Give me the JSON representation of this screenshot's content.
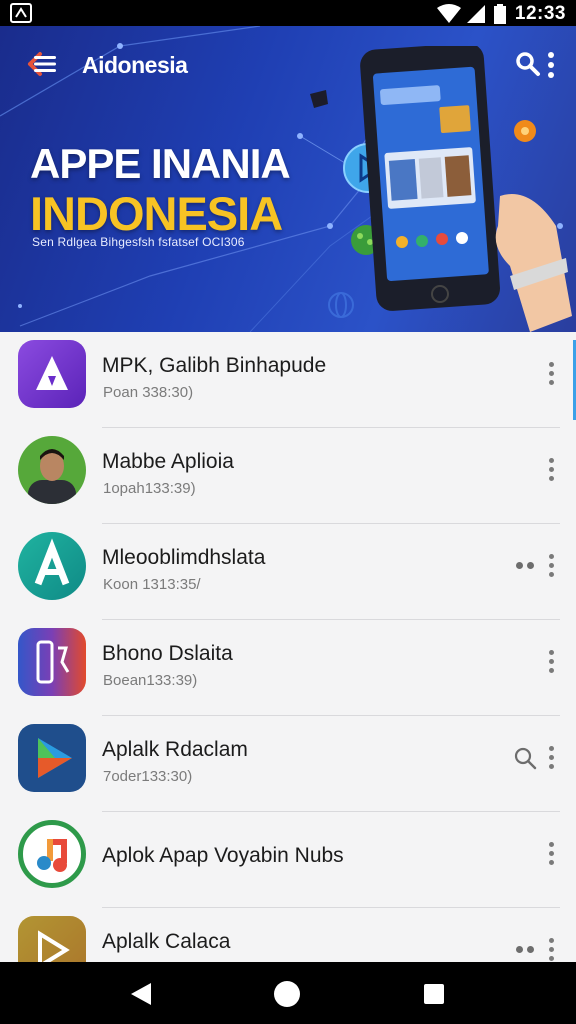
{
  "status_bar": {
    "time": "12:33"
  },
  "header": {
    "app_name": "Aidonesia",
    "banner_title_line1": "APPE INANIA",
    "banner_title_line2": "INDONESIA",
    "banner_subtitle": "Sen Rdlgea Bihgesfsh fsfatsef OCI306",
    "colors": {
      "banner": "#1f3fb3",
      "accent_yellow": "#f7c324"
    }
  },
  "apps": [
    {
      "name": "MPK, Galibh Binhapude",
      "sub": "Poan 338:30)",
      "icon": "purple-arrow-logo-icon",
      "action": "more"
    },
    {
      "name": "Mabbe Aplioia",
      "sub": "1opah133:39)",
      "icon": "user-avatar",
      "action": "more"
    },
    {
      "name": "Mleooblimdhslata",
      "sub": "Koon 1313:35/",
      "icon": "teal-a-logo-icon",
      "action": "pair-more"
    },
    {
      "name": "Bhono Dslaita",
      "sub": "Boean133:39)",
      "icon": "phone-app-icon",
      "action": "more"
    },
    {
      "name": "Aplalk Rdaclam",
      "sub": "7oder133:30)",
      "icon": "play-triangle-icon",
      "action": "search-more"
    },
    {
      "name": "Aplok Apap Voyabin Nubs",
      "sub": "",
      "icon": "music-note-icon",
      "action": "more"
    },
    {
      "name": "Aplalk Calaca",
      "sub": "",
      "icon": "play-video-icon",
      "action": "pair-more"
    }
  ]
}
